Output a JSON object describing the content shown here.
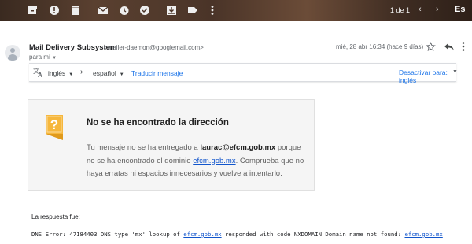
{
  "toolbar": {
    "pager": "1 de 1",
    "lang_label": "Es"
  },
  "message": {
    "sender_name": "Mail Delivery Subsystem",
    "sender_email": "<mailer-daemon@googlemail.com>",
    "recipient": "para mí",
    "date": "mié, 28 abr 16:34 (hace 9 días)"
  },
  "translate": {
    "from_lang": "inglés",
    "to_lang": "español",
    "translate_link": "Traducir mensaje",
    "deactivate_link": "Desactivar para: inglés"
  },
  "error_card": {
    "title": "No se ha encontrado la dirección",
    "body_part1": "Tu mensaje no se ha entregado a ",
    "address": "laurac@efcm.gob.mx",
    "body_part2": " porque no se ha encontrado el dominio ",
    "domain": "efcm.gob.mx",
    "body_part3": ". Comprueba que no haya erratas ni espacios innecesarios y vuelve a intentarlo."
  },
  "response": {
    "label": "La respuesta fue:",
    "dns_part1": "DNS Error: 47184403 DNS type 'mx' lookup of ",
    "dns_domain1": "efcm.gob.mx",
    "dns_part2": " responded with code NXDOMAIN Domain name not found: ",
    "dns_domain2": "efcm.gob.mx"
  },
  "colors": {
    "link": "#1a73e8",
    "warning": "#f6b73c"
  }
}
